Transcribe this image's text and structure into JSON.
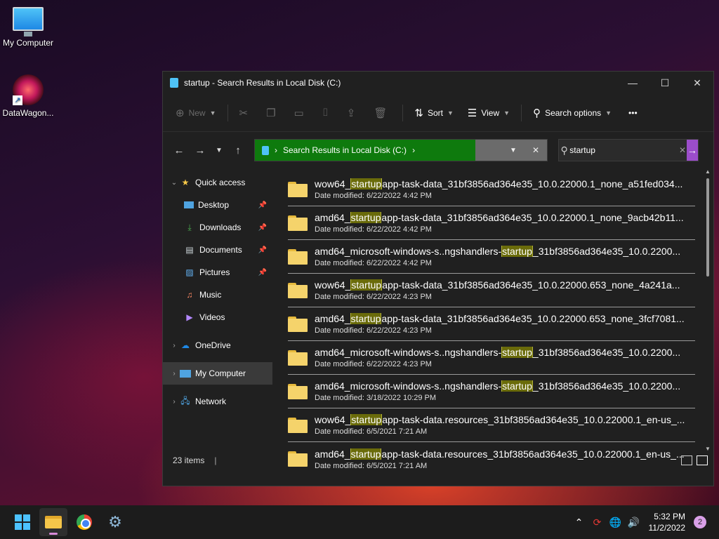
{
  "desktop": {
    "icons": [
      {
        "label": "My Computer"
      },
      {
        "label": "DataWagon..."
      }
    ]
  },
  "window": {
    "title": "startup - Search Results in Local Disk (C:)",
    "controls": {
      "minimize": "—",
      "maximize": "☐",
      "close": "✕"
    }
  },
  "toolbar": {
    "new_label": "New",
    "sort_label": "Sort",
    "view_label": "View",
    "search_options_label": "Search options",
    "more_label": "•••"
  },
  "address": {
    "path_label": "Search Results in Local Disk (C:)",
    "separator": "›"
  },
  "search": {
    "value": "startup"
  },
  "sidebar": {
    "quick_access": "Quick access",
    "items": [
      {
        "label": "Desktop",
        "icon": "desktop-icon",
        "pinned": true
      },
      {
        "label": "Downloads",
        "icon": "download-icon",
        "pinned": true
      },
      {
        "label": "Documents",
        "icon": "document-icon",
        "pinned": true
      },
      {
        "label": "Pictures",
        "icon": "pictures-icon",
        "pinned": true
      },
      {
        "label": "Music",
        "icon": "music-icon",
        "pinned": false
      },
      {
        "label": "Videos",
        "icon": "videos-icon",
        "pinned": false
      }
    ],
    "onedrive": "OneDrive",
    "my_computer": "My Computer",
    "network": "Network"
  },
  "files": [
    {
      "pre": "wow64_",
      "hl": "startup",
      "post": "app-task-data_31bf3856ad364e35_10.0.22000.1_none_a51fed034...",
      "date": "Date modified: 6/22/2022 4:42 PM"
    },
    {
      "pre": "amd64_",
      "hl": "startup",
      "post": "app-task-data_31bf3856ad364e35_10.0.22000.1_none_9acb42b11...",
      "date": "Date modified: 6/22/2022 4:42 PM"
    },
    {
      "pre": "amd64_microsoft-windows-s..ngshandlers-",
      "hl": "startup",
      "post": "_31bf3856ad364e35_10.0.2200...",
      "date": "Date modified: 6/22/2022 4:42 PM"
    },
    {
      "pre": "wow64_",
      "hl": "startup",
      "post": "app-task-data_31bf3856ad364e35_10.0.22000.653_none_4a241a...",
      "date": "Date modified: 6/22/2022 4:23 PM"
    },
    {
      "pre": "amd64_",
      "hl": "startup",
      "post": "app-task-data_31bf3856ad364e35_10.0.22000.653_none_3fcf7081...",
      "date": "Date modified: 6/22/2022 4:23 PM"
    },
    {
      "pre": "amd64_microsoft-windows-s..ngshandlers-",
      "hl": "startup",
      "post": "_31bf3856ad364e35_10.0.2200...",
      "date": "Date modified: 6/22/2022 4:23 PM"
    },
    {
      "pre": "amd64_microsoft-windows-s..ngshandlers-",
      "hl": "startup",
      "post": "_31bf3856ad364e35_10.0.2200...",
      "date": "Date modified: 3/18/2022 10:29 PM"
    },
    {
      "pre": "wow64_",
      "hl": "startup",
      "post": "app-task-data.resources_31bf3856ad364e35_10.0.22000.1_en-us_...",
      "date": "Date modified: 6/5/2021 7:21 AM"
    },
    {
      "pre": "amd64_",
      "hl": "startup",
      "post": "app-task-data.resources_31bf3856ad364e35_10.0.22000.1_en-us_...",
      "date": "Date modified: 6/5/2021 7:21 AM"
    }
  ],
  "status": {
    "item_count": "23 items"
  },
  "taskbar": {
    "time": "5:32 PM",
    "date": "11/2/2022",
    "notifications": "2"
  },
  "colors": {
    "highlight": "#6a6b0a",
    "address_green": "#0e7a0d",
    "search_go": "#9b4dca",
    "accent": "#4cc2ff"
  }
}
